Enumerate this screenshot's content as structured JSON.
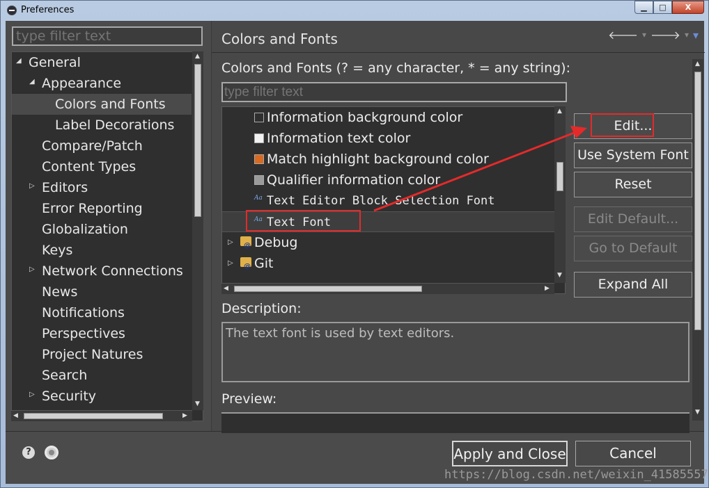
{
  "window": {
    "title": "Preferences",
    "minimize": "▁",
    "maximize": "□",
    "close": "X"
  },
  "left": {
    "filter_placeholder": "type filter text",
    "tree": [
      {
        "label": "General",
        "twisty": "◢",
        "level": 0
      },
      {
        "label": "Appearance",
        "twisty": "◢",
        "level": 1
      },
      {
        "label": "Colors and Fonts",
        "twisty": "",
        "level": 2,
        "selected": true
      },
      {
        "label": "Label Decorations",
        "twisty": "",
        "level": 2
      },
      {
        "label": "Compare/Patch",
        "twisty": "",
        "level": 1
      },
      {
        "label": "Content Types",
        "twisty": "",
        "level": 1
      },
      {
        "label": "Editors",
        "twisty": "▷",
        "level": 1
      },
      {
        "label": "Error Reporting",
        "twisty": "",
        "level": 1
      },
      {
        "label": "Globalization",
        "twisty": "",
        "level": 1
      },
      {
        "label": "Keys",
        "twisty": "",
        "level": 1
      },
      {
        "label": "Network Connections",
        "twisty": "▷",
        "level": 1
      },
      {
        "label": "News",
        "twisty": "",
        "level": 1
      },
      {
        "label": "Notifications",
        "twisty": "",
        "level": 1
      },
      {
        "label": "Perspectives",
        "twisty": "",
        "level": 1
      },
      {
        "label": "Project Natures",
        "twisty": "",
        "level": 1
      },
      {
        "label": "Search",
        "twisty": "",
        "level": 1
      },
      {
        "label": "Security",
        "twisty": "▷",
        "level": 1
      }
    ]
  },
  "right": {
    "page_title": "Colors and Fonts",
    "nav_back": "🡐",
    "nav_forward": "🡒",
    "nav_menu": "▾",
    "section_label": "Colors and Fonts (? = any character, * = any string):",
    "filter_placeholder": "type filter text",
    "items": [
      {
        "label": "Information background color",
        "kind": "color",
        "color": "#2f2f2f"
      },
      {
        "label": "Information text color",
        "kind": "color",
        "color": "#f2f2f2"
      },
      {
        "label": "Match highlight background color",
        "kind": "color",
        "color": "#d96a1f"
      },
      {
        "label": "Qualifier information color",
        "kind": "color",
        "color": "#9a9a9a"
      },
      {
        "label": "Text Editor Block Selection Font",
        "kind": "font"
      },
      {
        "label": "Text Font",
        "kind": "font",
        "selected": true
      },
      {
        "label": "Debug",
        "kind": "category"
      },
      {
        "label": "Git",
        "kind": "category"
      }
    ],
    "buttons": {
      "edit": "Edit...",
      "use_system_font": "Use System Font",
      "reset": "Reset",
      "edit_default": "Edit Default...",
      "go_to_default": "Go to Default",
      "expand_all": "Expand All"
    },
    "description_label": "Description:",
    "description_text": "The text font is used by text editors.",
    "preview_label": "Preview:"
  },
  "footer": {
    "apply_close": "Apply and Close",
    "cancel": "Cancel",
    "help": "?"
  },
  "watermark": "https://blog.csdn.net/weixin_41585557",
  "colors": {
    "annotation": "#e52a2a",
    "background": "#4b4b4b",
    "tree_bg": "#2f2f2f"
  }
}
